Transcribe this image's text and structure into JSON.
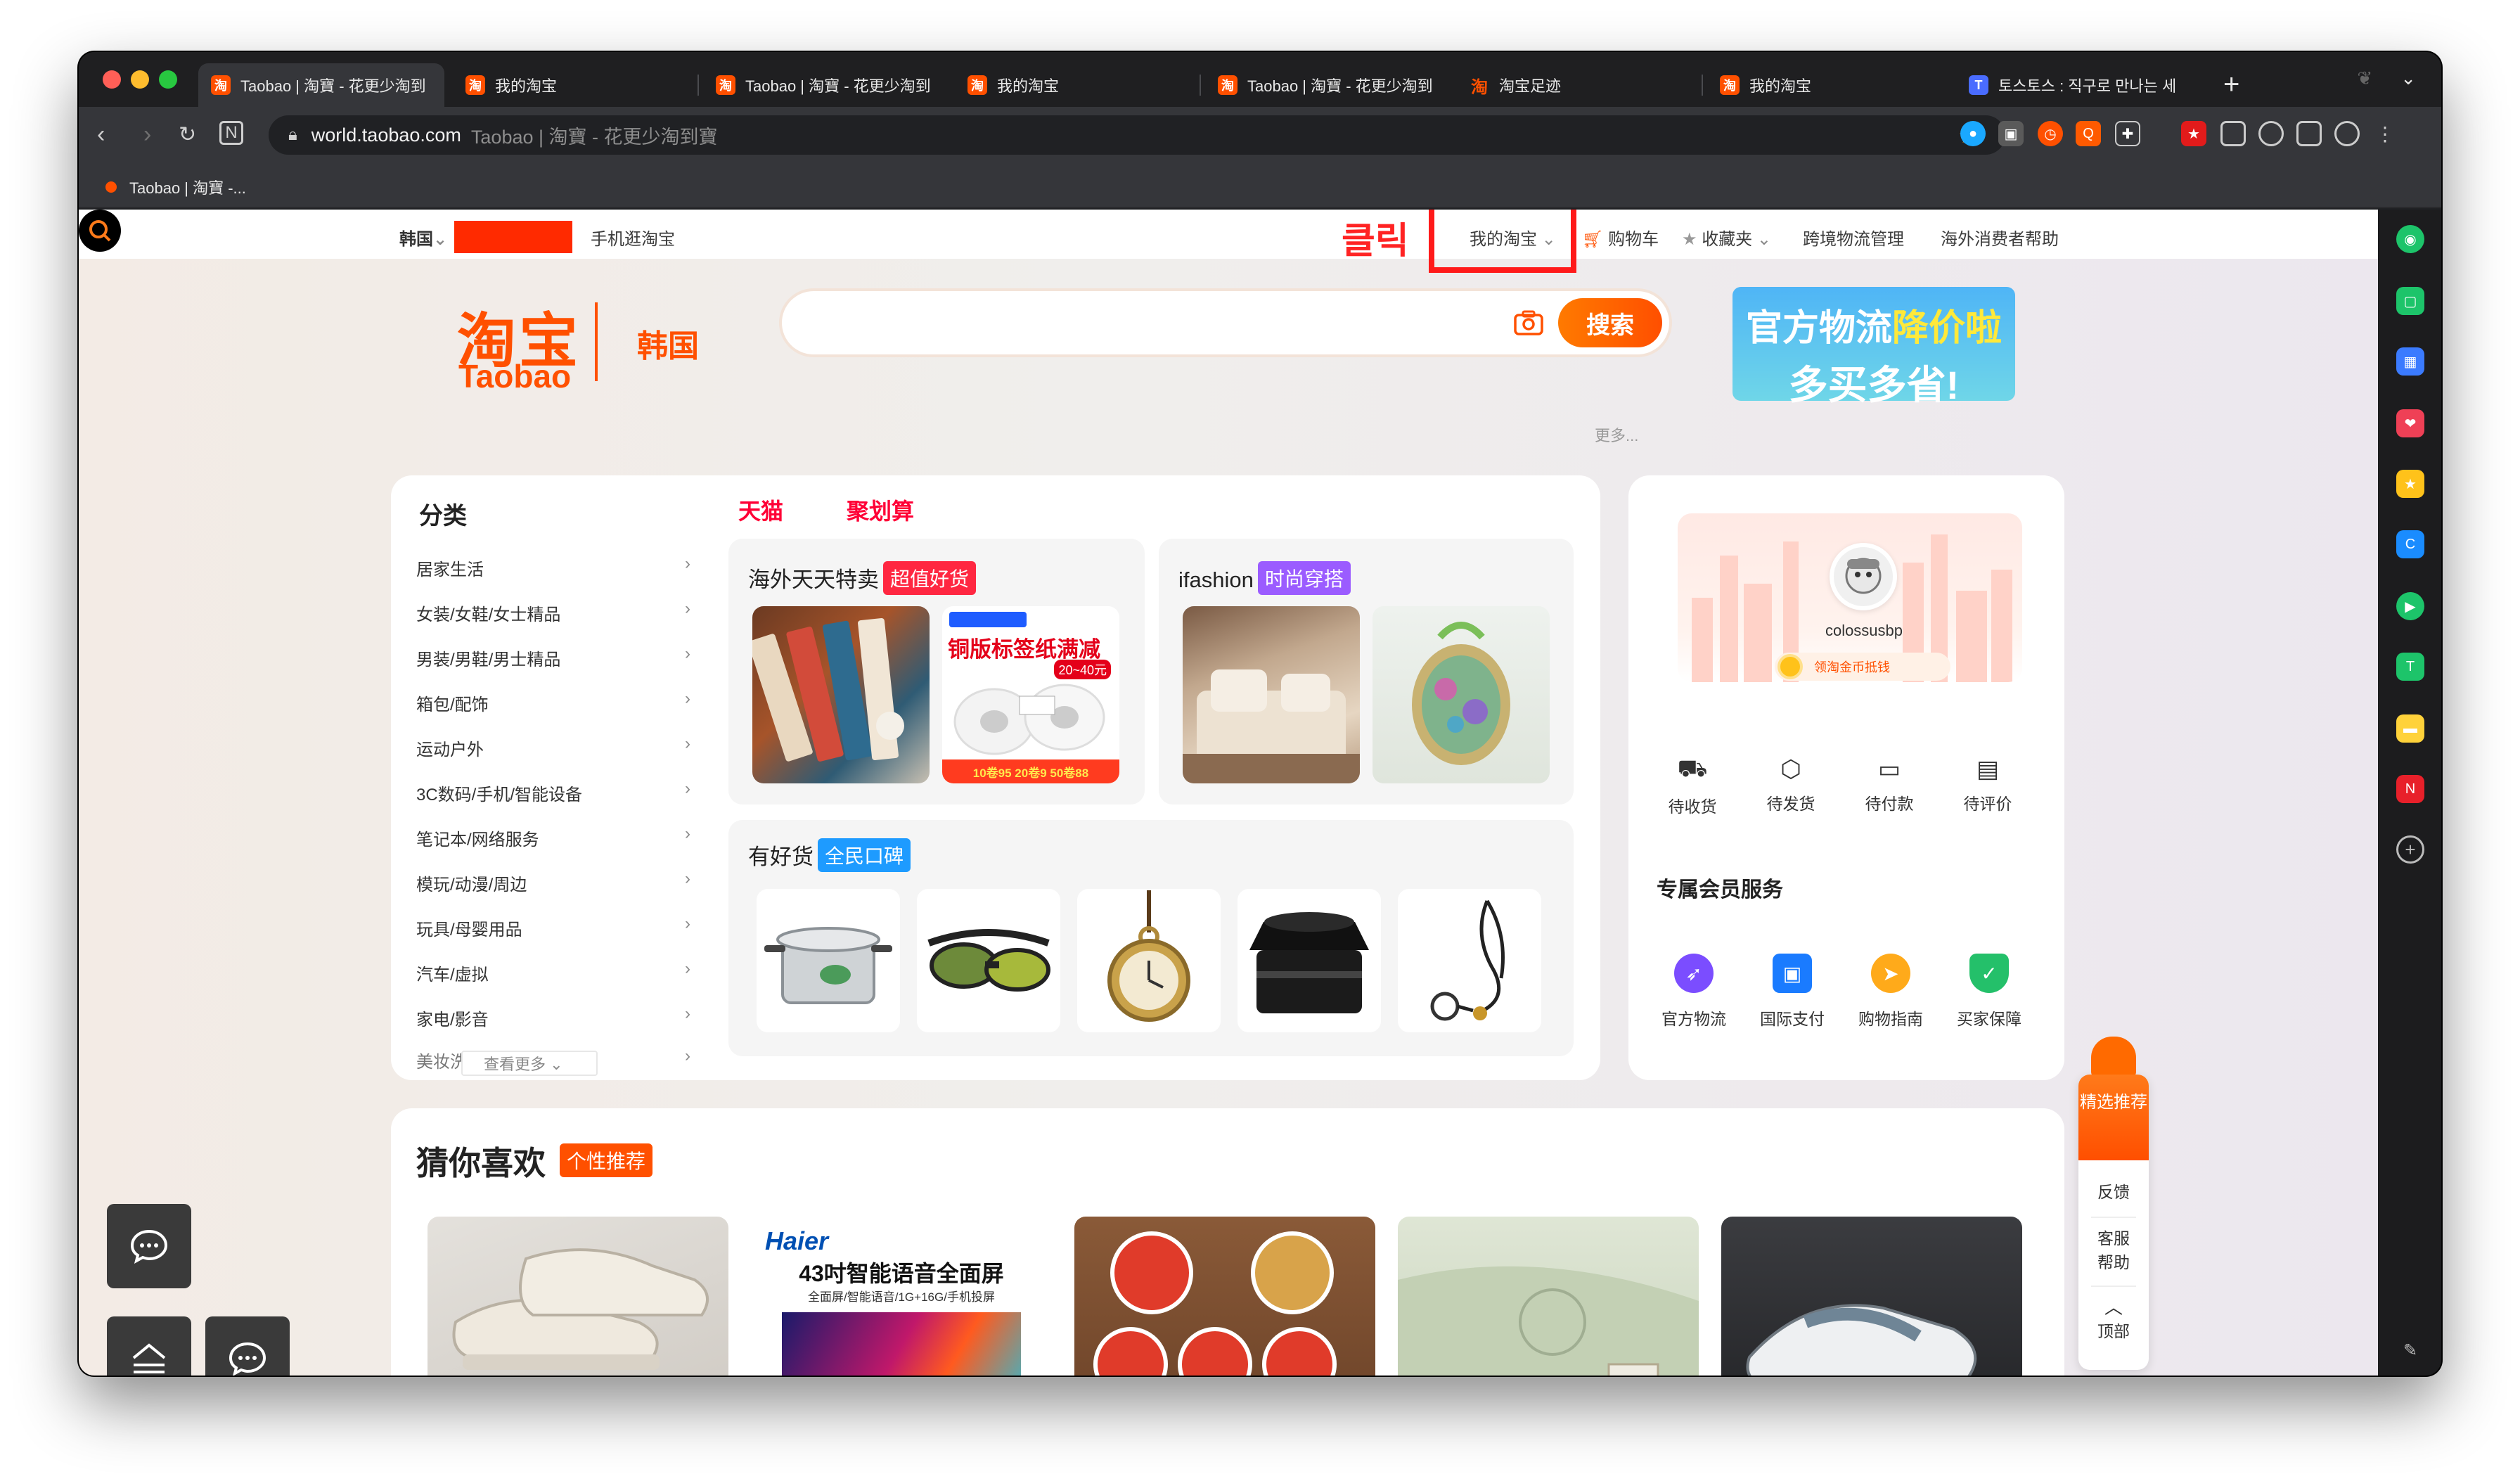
{
  "browser": {
    "tabs": [
      {
        "title": "Taobao | 淘寶 - 花更少淘到"
      },
      {
        "title": "我的淘宝"
      },
      {
        "title": "Taobao | 淘寶 - 花更少淘到"
      },
      {
        "title": "我的淘宝"
      },
      {
        "title": "Taobao | 淘寶 - 花更少淘到"
      },
      {
        "title": "淘宝足迹"
      },
      {
        "title": "我的淘宝"
      },
      {
        "title": "토스토스 : 직구로 만나는 세"
      }
    ],
    "new_tab": "+",
    "url": "world.taobao.com",
    "page_title": "Taobao | 淘寶 - 花更少淘到寶",
    "bookmark": "Taobao | 淘寶 -..."
  },
  "colors": {
    "brand": "#ff5000",
    "tmall": "#ff0036",
    "annotation": "#ff1a1a"
  },
  "sitebar": {
    "region": "韩国",
    "region_chevron": "⌄",
    "mobile": "手机逛淘宝",
    "annotation": "클릭",
    "my_taobao": "我的淘宝",
    "cart": "购物车",
    "favorites": "收藏夹",
    "logistics": "跨境物流管理",
    "help": "海外消费者帮助"
  },
  "header": {
    "logo_cn": "淘宝",
    "logo_en": "Taobao",
    "country": "韩国",
    "search_button": "搜索",
    "more": "更多...",
    "promo_line1_a": "官方物流",
    "promo_line1_b": "降价啦",
    "promo_line2": "多买多省!"
  },
  "categories": {
    "title": "分类",
    "items": [
      "居家生活",
      "女装/女鞋/女士精品",
      "男装/男鞋/男士精品",
      "箱包/配饰",
      "运动户外",
      "3C数码/手机/智能设备",
      "笔记本/网络服务",
      "模玩/动漫/周边",
      "玩具/母婴用品",
      "汽车/虚拟",
      "家电/影音",
      "美妆洗"
    ],
    "see_more": "查看更多"
  },
  "channels": {
    "tmall": "天猫",
    "juhuasuan": "聚划算",
    "overseas": {
      "title": "海外天天特卖",
      "tag": "超值好货"
    },
    "ifashion": {
      "title": "ifashion",
      "tag": "时尚穿搭"
    },
    "good": {
      "title": "有好货",
      "tag": "全民口碑"
    },
    "label_promo": {
      "badge": "铜版标签纸满减",
      "sub": "20~40元",
      "prices": "10卷95 20卷9 50卷88"
    }
  },
  "user": {
    "name": "colossusbp",
    "coins": "领淘金币抵钱",
    "orders": [
      {
        "label": "待收货",
        "icon": "truck-icon"
      },
      {
        "label": "待发货",
        "icon": "box-icon"
      },
      {
        "label": "待付款",
        "icon": "wallet-icon"
      },
      {
        "label": "待评价",
        "icon": "comment-icon"
      }
    ],
    "vip_title": "专属会员服务",
    "services": [
      {
        "label": "官方物流",
        "color": "#7b4dff"
      },
      {
        "label": "国际支付",
        "color": "#1a7bff"
      },
      {
        "label": "购物指南",
        "color": "#ffaa1a"
      },
      {
        "label": "买家保障",
        "color": "#24c06a"
      }
    ]
  },
  "recommend": {
    "title": "猜你喜欢",
    "tag": "个性推荐",
    "haier_brand": "Haier",
    "haier_line1": "43吋智能语音全面屏",
    "haier_line2": "全面屏/智能语音/1G+16G/手机投屏"
  },
  "floatbar": {
    "featured": "精选推荐",
    "feedback": "反馈",
    "service": "客服帮助",
    "top": "顶部"
  }
}
